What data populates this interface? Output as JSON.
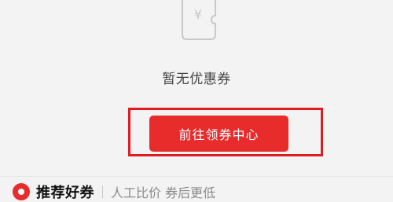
{
  "empty_state": {
    "icon": "coupon-yen-icon",
    "message": "暂无优惠券",
    "button_label": "前往领券中心"
  },
  "recommend": {
    "title": "推荐好券",
    "subtitle": "人工比价 券后更低"
  },
  "colors": {
    "primary_red": "#e82c2c",
    "highlight_red": "#e11b22",
    "background": "#f3f3f3"
  }
}
